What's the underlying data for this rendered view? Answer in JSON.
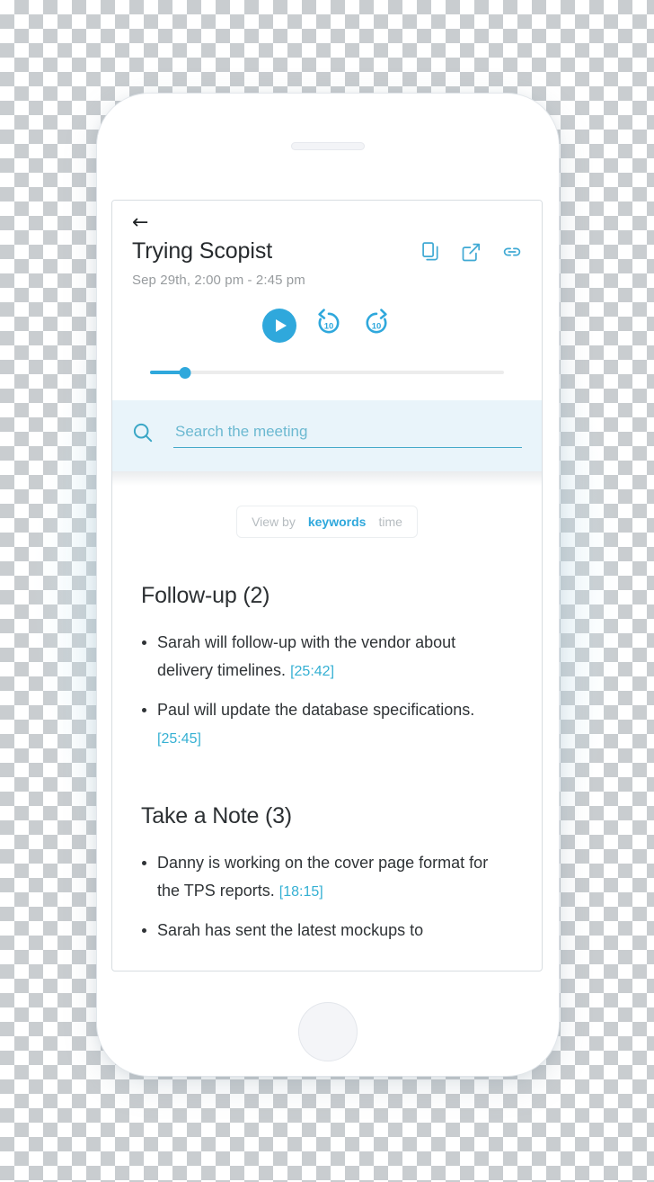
{
  "app": {
    "back_icon": "back-arrow-icon",
    "meeting_title": "Trying Scopist",
    "meeting_date": "Sep 29th, 2:00 pm - 2:45 pm",
    "header_icons": [
      {
        "name": "copy-icon",
        "label": "Copy"
      },
      {
        "name": "share-external-icon",
        "label": "Open / Share"
      },
      {
        "name": "link-icon",
        "label": "Copy link"
      }
    ]
  },
  "player": {
    "play_label": "Play",
    "rewind_label": "10",
    "forward_label": "10",
    "progress_percent": 10
  },
  "search": {
    "placeholder": "Search the meeting",
    "value": "",
    "icon": "search-icon"
  },
  "view_by": {
    "label": "View by",
    "options": [
      {
        "label": "keywords",
        "selected": true
      },
      {
        "label": "time",
        "selected": false
      }
    ]
  },
  "sections": [
    {
      "title": "Follow-up (2)",
      "items": [
        {
          "text": "Sarah will follow-up with the vendor about delivery timelines.",
          "timestamp": "[25:42]"
        },
        {
          "text": "Paul will update the database specifications.",
          "timestamp": "[25:45]"
        }
      ]
    },
    {
      "title": "Take a Note (3)",
      "items": [
        {
          "text": "Danny is working on the cover page format for the TPS reports.",
          "timestamp": "[18:15]"
        },
        {
          "text": "Sarah has sent the latest mockups to",
          "timestamp": ""
        }
      ]
    }
  ],
  "colors": {
    "accent": "#2fa8dc",
    "timestamp": "#35b0d3",
    "search_bg": "#e9f4fa",
    "muted_text": "#979b9e",
    "body_text": "#2f3336"
  }
}
